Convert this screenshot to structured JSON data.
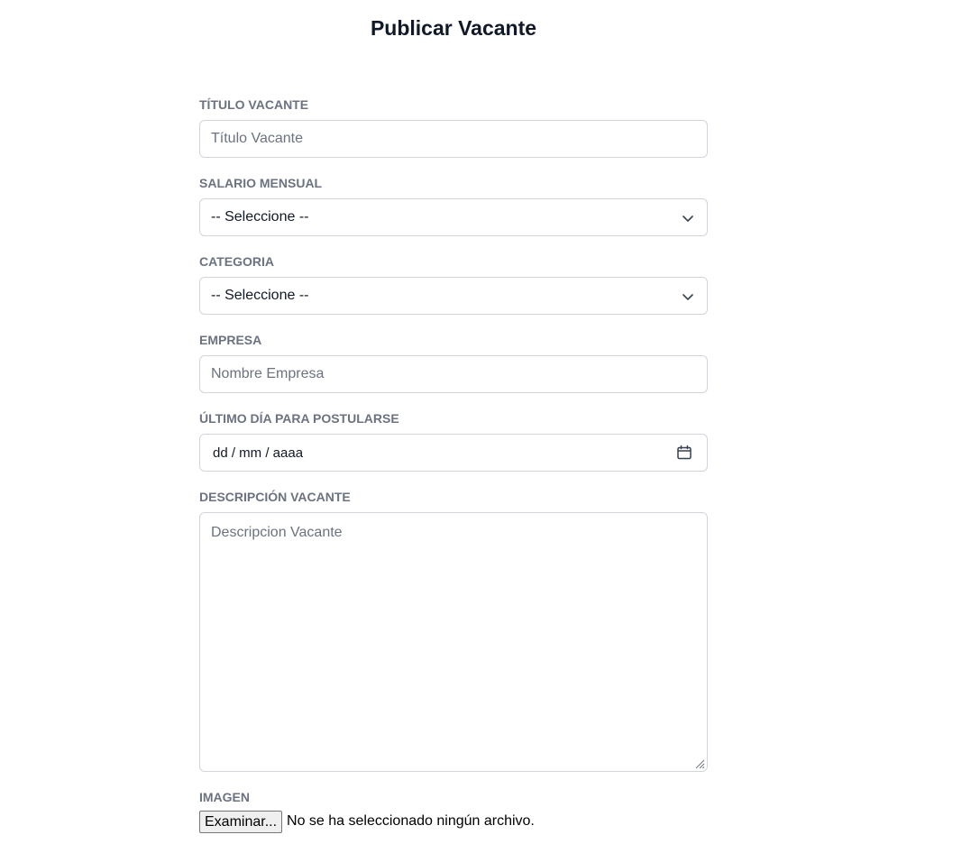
{
  "page": {
    "title": "Publicar Vacante"
  },
  "form": {
    "titulo": {
      "label": "TÍTULO VACANTE",
      "placeholder": "Título Vacante"
    },
    "salario": {
      "label": "SALARIO MENSUAL",
      "selected": "-- Seleccione --"
    },
    "categoria": {
      "label": "CATEGORIA",
      "selected": "-- Seleccione --"
    },
    "empresa": {
      "label": "EMPRESA",
      "placeholder": "Nombre Empresa"
    },
    "ultimo_dia": {
      "label": "ÚLTIMO DÍA PARA POSTULARSE",
      "value": "dd / mm / aaaa"
    },
    "descripcion": {
      "label": "DESCRIPCIÓN VACANTE",
      "placeholder": "Descripcion Vacante"
    },
    "imagen": {
      "label": "IMAGEN",
      "button_label": "Examinar...",
      "status": "No se ha seleccionado ningún archivo."
    }
  },
  "icons": {
    "select_chevron": "chevron-down-icon",
    "date_picker": "calendar-icon",
    "resize": "resize-handle-icon"
  },
  "colors": {
    "label_text": "#6b7280",
    "border": "#d1d5db",
    "title_text": "#111827"
  }
}
